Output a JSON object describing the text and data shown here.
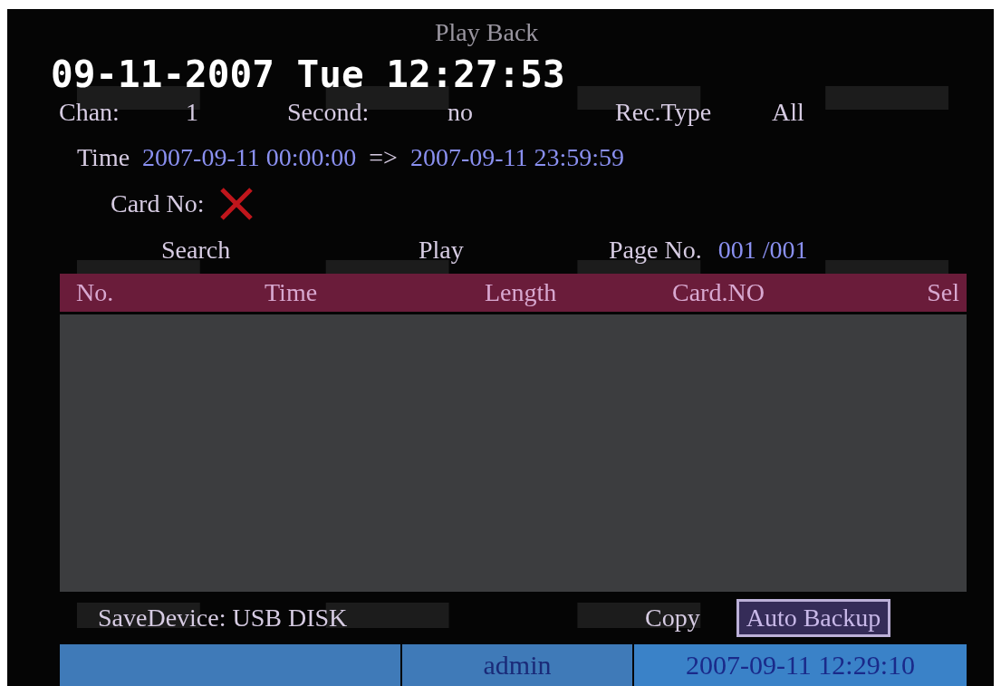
{
  "clock": "09-11-2007 Tue 12:27:53",
  "title": "Play Back",
  "fields": [
    {
      "label": "Chan:",
      "value": "1"
    },
    {
      "label": "Second:",
      "value": "no"
    },
    {
      "label": "Rec.Type",
      "value": "All"
    }
  ],
  "time_range": {
    "label": "Time",
    "start": "2007-09-11  00:00:00",
    "arrow": "=>",
    "end": "2007-09-11  23:59:59"
  },
  "card_no": {
    "label": "Card No:"
  },
  "actions": [
    {
      "label": "Search"
    },
    {
      "label": "Play"
    }
  ],
  "page": {
    "label": "Page No.",
    "value": "001 /001"
  },
  "table": {
    "columns": [
      "No.",
      "Time",
      "Length",
      "Card.NO",
      "Sel"
    ]
  },
  "save_device": {
    "label": "SaveDevice:",
    "value": "USB DISK"
  },
  "buttons": [
    {
      "label": "Copy",
      "selected": false
    },
    {
      "label": "Auto Backup",
      "selected": true
    }
  ],
  "status_bar": {
    "user": "admin",
    "datetime": "2007-09-11 12:29:10"
  }
}
